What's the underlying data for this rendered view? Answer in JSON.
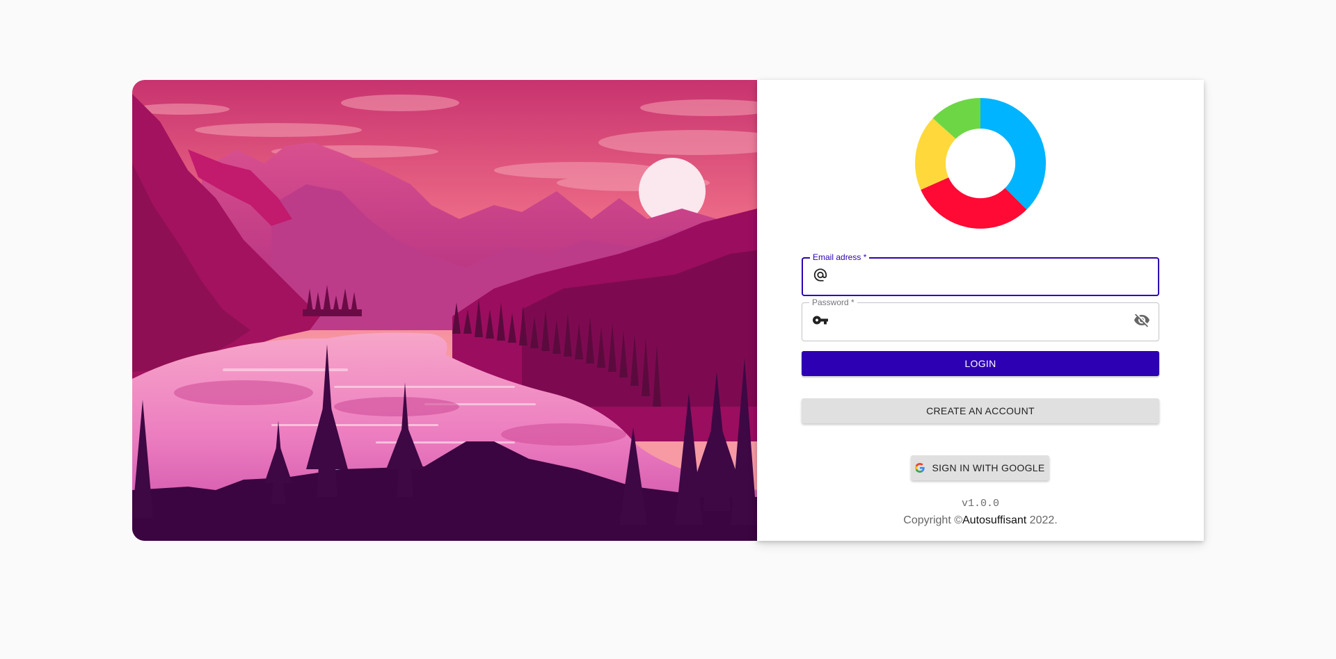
{
  "colors": {
    "primary": "#2d00b3",
    "secondary_button": "#e0e0e0",
    "logo_segments": [
      "#00b4ff",
      "#ff0a35",
      "#ffd93b",
      "#6dd645"
    ]
  },
  "hero": {
    "image": "pink-mountain-lake-landscape-illustration"
  },
  "logo": {
    "icon": "donut-logo-icon"
  },
  "form": {
    "email_label": "Email adress *",
    "email_value": "",
    "email_icon": "at-sign-icon",
    "password_label": "Password *",
    "password_value": "",
    "password_icon": "key-icon",
    "visibility_icon": "eye-off-icon"
  },
  "buttons": {
    "login": "LOGIN",
    "create_account": "CREATE AN ACCOUNT",
    "google": "SIGN IN WITH GOOGLE",
    "google_icon": "google-g-icon"
  },
  "footer": {
    "version": "v1.0.0",
    "copyright_prefix": "Copyright ©",
    "company": "Autosuffisant",
    "copyright_suffix": " 2022."
  }
}
